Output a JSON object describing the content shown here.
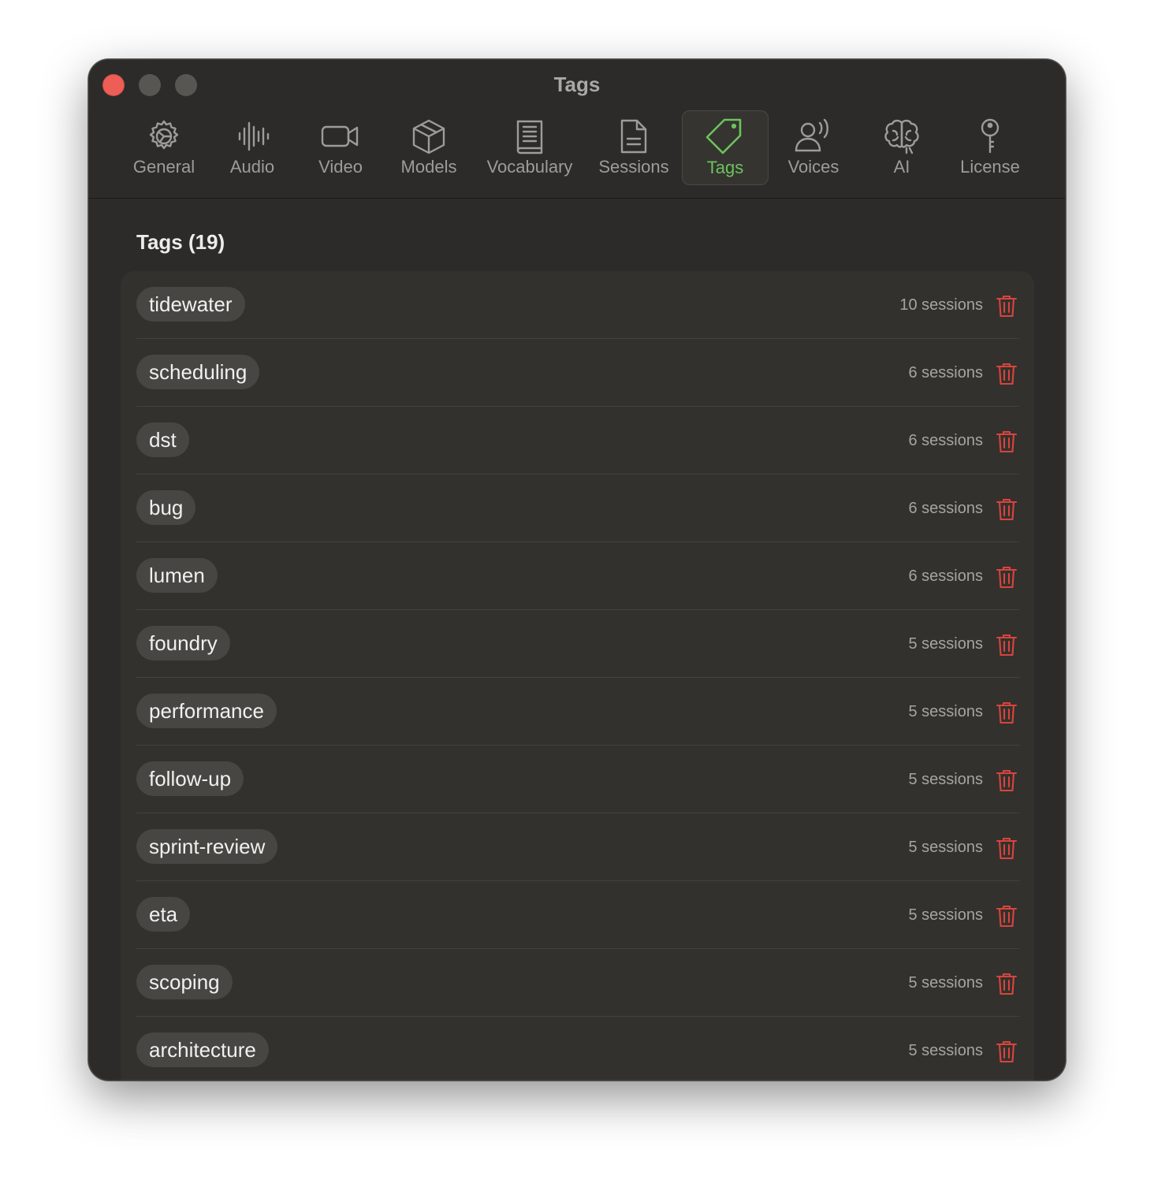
{
  "window": {
    "title": "Tags"
  },
  "toolbar": {
    "tabs": [
      {
        "label": "General",
        "icon": "gear-icon"
      },
      {
        "label": "Audio",
        "icon": "waveform-icon"
      },
      {
        "label": "Video",
        "icon": "video-camera-icon"
      },
      {
        "label": "Models",
        "icon": "cube-icon"
      },
      {
        "label": "Vocabulary",
        "icon": "book-icon"
      },
      {
        "label": "Sessions",
        "icon": "document-icon"
      },
      {
        "label": "Tags",
        "icon": "tag-icon",
        "selected": true
      },
      {
        "label": "Voices",
        "icon": "person-speaking-icon"
      },
      {
        "label": "AI",
        "icon": "brain-icon"
      },
      {
        "label": "License",
        "icon": "key-icon"
      }
    ]
  },
  "main": {
    "title": "Tags (19)",
    "tags": [
      {
        "name": "tidewater",
        "sessions": "10 sessions"
      },
      {
        "name": "scheduling",
        "sessions": "6 sessions"
      },
      {
        "name": "dst",
        "sessions": "6 sessions"
      },
      {
        "name": "bug",
        "sessions": "6 sessions"
      },
      {
        "name": "lumen",
        "sessions": "6 sessions"
      },
      {
        "name": "foundry",
        "sessions": "5 sessions"
      },
      {
        "name": "performance",
        "sessions": "5 sessions"
      },
      {
        "name": "follow-up",
        "sessions": "5 sessions"
      },
      {
        "name": "sprint-review",
        "sessions": "5 sessions"
      },
      {
        "name": "eta",
        "sessions": "5 sessions"
      },
      {
        "name": "scoping",
        "sessions": "5 sessions"
      },
      {
        "name": "architecture",
        "sessions": "5 sessions"
      }
    ]
  },
  "colors": {
    "accent": "#6cc35b",
    "delete": "#d9443c",
    "window_bg": "#2c2b29",
    "list_bg": "#32312e",
    "pill_bg": "#474643"
  }
}
